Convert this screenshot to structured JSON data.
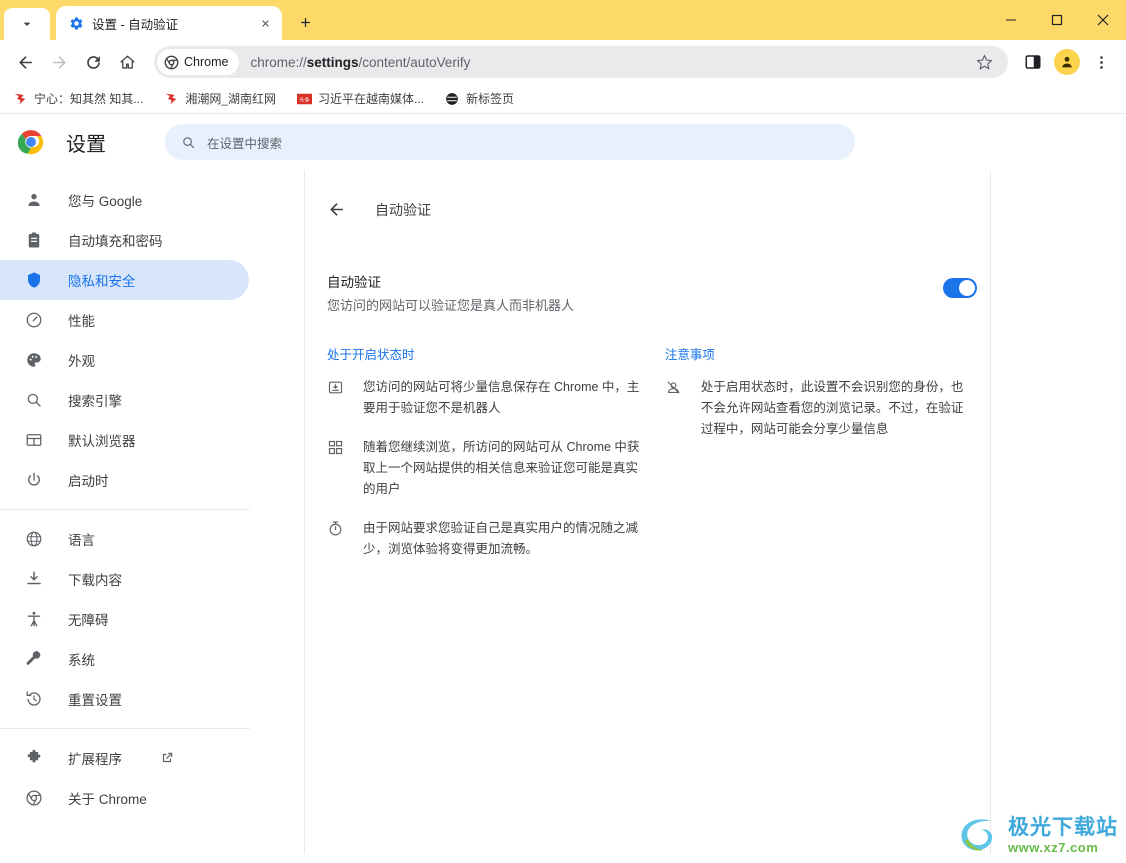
{
  "window": {
    "tab_search_icon": "chevron-down-icon",
    "tab": {
      "favicon": "gear-icon",
      "title": "设置 - 自动验证",
      "close_icon": "close-icon"
    },
    "new_tab_label": "+",
    "controls": {
      "minimize": "minimize-icon",
      "maximize": "maximize-icon",
      "close": "close-icon"
    },
    "tabstrip_color": "#fcd968"
  },
  "toolbar": {
    "back_icon": "back-arrow-icon",
    "forward_icon": "forward-arrow-icon",
    "reload_icon": "reload-icon",
    "home_icon": "home-icon",
    "chrome_chip_label": "Chrome",
    "url_prefix": "chrome://",
    "url_bold": "settings",
    "url_suffix": "/content/autoVerify",
    "star_icon": "bookmark-star-icon",
    "side_panel_icon": "side-panel-icon",
    "avatar_icon": "profile-avatar-icon",
    "menu_icon": "three-dot-menu-icon"
  },
  "bookmarks": [
    {
      "icon": "site-favicon-red",
      "label": "宁心：知其然 知其..."
    },
    {
      "icon": "site-favicon-red",
      "label": "湘潮网_湖南红网"
    },
    {
      "icon": "site-favicon-toutiao",
      "label": "习近平在越南媒体..."
    },
    {
      "icon": "site-favicon-globe",
      "label": "新标签页"
    }
  ],
  "settings_header": {
    "logo": "chrome-logo-icon",
    "title": "设置",
    "search_icon": "search-icon",
    "search_placeholder": "在设置中搜索",
    "search_value": ""
  },
  "sidebar": {
    "groups": [
      {
        "items": [
          {
            "icon": "person-icon",
            "label": "您与 Google",
            "selected": false
          },
          {
            "icon": "clipboard-icon",
            "label": "自动填充和密码",
            "selected": false
          },
          {
            "icon": "shield-icon",
            "label": "隐私和安全",
            "selected": true
          },
          {
            "icon": "speedometer-icon",
            "label": "性能",
            "selected": false
          },
          {
            "icon": "palette-icon",
            "label": "外观",
            "selected": false
          },
          {
            "icon": "search-icon",
            "label": "搜索引擎",
            "selected": false
          },
          {
            "icon": "browser-icon",
            "label": "默认浏览器",
            "selected": false
          },
          {
            "icon": "power-icon",
            "label": "启动时",
            "selected": false
          }
        ]
      },
      {
        "items": [
          {
            "icon": "globe-icon",
            "label": "语言",
            "selected": false
          },
          {
            "icon": "download-icon",
            "label": "下载内容",
            "selected": false
          },
          {
            "icon": "accessibility-icon",
            "label": "无障碍",
            "selected": false
          },
          {
            "icon": "wrench-icon",
            "label": "系统",
            "selected": false
          },
          {
            "icon": "restore-icon",
            "label": "重置设置",
            "selected": false
          }
        ]
      },
      {
        "items": [
          {
            "icon": "puzzle-icon",
            "label": "扩展程序",
            "selected": false,
            "external": true
          },
          {
            "icon": "chrome-icon",
            "label": "关于 Chrome",
            "selected": false
          }
        ]
      }
    ]
  },
  "main": {
    "back_icon": "back-arrow-icon",
    "page_title": "自动验证",
    "setting": {
      "name": "自动验证",
      "description": "您访问的网站可以验证您是真人而非机器人",
      "toggle_on": true,
      "toggle_color": "#1a73e8"
    },
    "left_column": {
      "title": "处于开启状态时",
      "bullets": [
        {
          "icon": "save-box-icon",
          "text": "您访问的网站可将少量信息保存在 Chrome 中，主要用于验证您不是机器人"
        },
        {
          "icon": "grid-squares-icon",
          "text": "随着您继续浏览，所访问的网站可从 Chrome 中获取上一个网站提供的相关信息来验证您可能是真实的用户"
        },
        {
          "icon": "stopwatch-icon",
          "text": "由于网站要求您验证自己是真实用户的情况随之减少，浏览体验将变得更加流畅。"
        }
      ]
    },
    "right_column": {
      "title": "注意事项",
      "bullets": [
        {
          "icon": "visibility-off-icon",
          "text": "处于启用状态时，此设置不会识别您的身份，也不会允许网站查看您的浏览记录。不过，在验证过程中，网站可能会分享少量信息"
        }
      ]
    }
  },
  "watermark": {
    "icon": "aurora-logo-icon",
    "title": "极光下载站",
    "url": "www.xz7.com"
  }
}
